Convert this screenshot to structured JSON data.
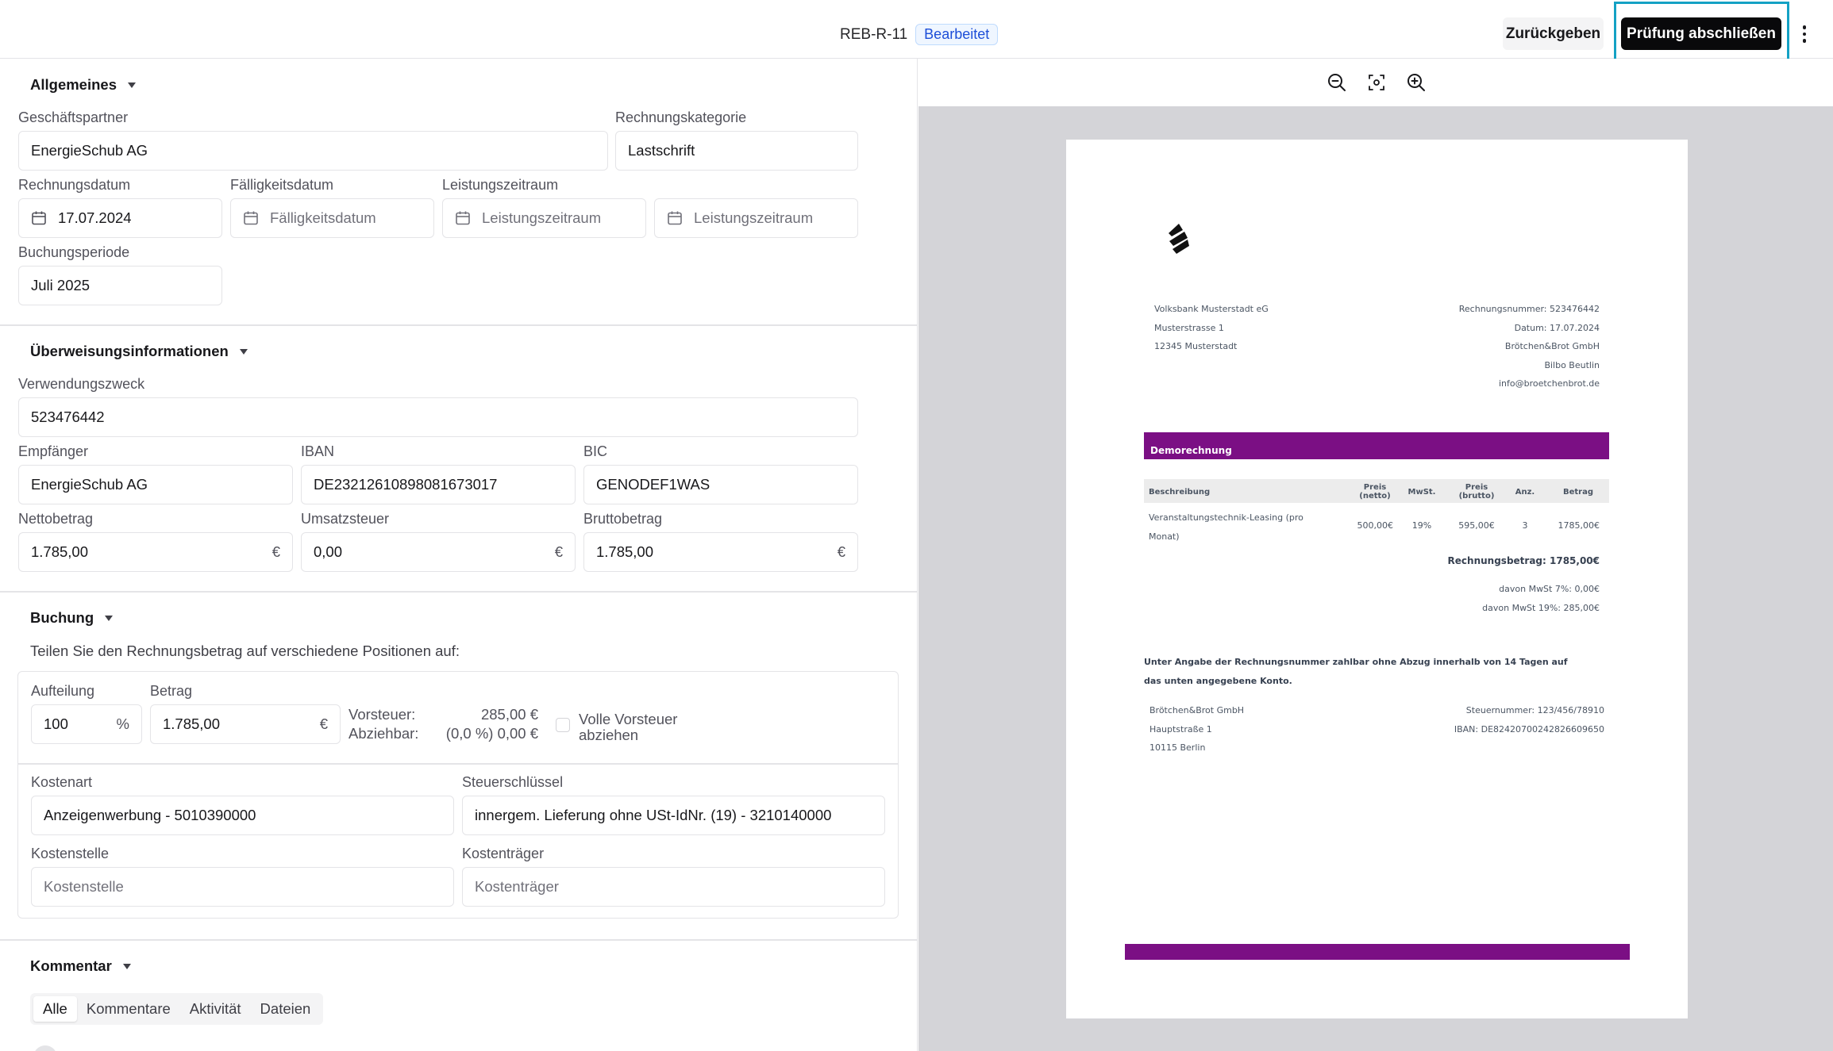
{
  "header": {
    "doc_id": "REB-R-11",
    "status_badge": "Bearbeitet",
    "return_button": "Zurückgeben",
    "complete_button": "Prüfung abschließen"
  },
  "allgemeines": {
    "title": "Allgemeines",
    "partner_label": "Geschäftspartner",
    "partner_value": "EnergieSchub AG",
    "category_label": "Rechnungskategorie",
    "category_value": "Lastschrift",
    "invoice_date_label": "Rechnungsdatum",
    "invoice_date_value": "17.07.2024",
    "due_date_label": "Fälligkeitsdatum",
    "due_date_placeholder": "Fälligkeitsdatum",
    "service_period_label": "Leistungszeitraum",
    "service_start_placeholder": "Leistungszeitraum",
    "service_end_placeholder": "Leistungszeitraum",
    "booking_period_label": "Buchungsperiode",
    "booking_period_value": "Juli 2025"
  },
  "transfer": {
    "title": "Überweisungsinformationen",
    "purpose_label": "Verwendungszweck",
    "purpose_value": "523476442",
    "recipient_label": "Empfänger",
    "recipient_value": "EnergieSchub AG",
    "iban_label": "IBAN",
    "iban_value": "DE23212610898081673017",
    "bic_label": "BIC",
    "bic_value": "GENODEF1WAS",
    "net_label": "Nettobetrag",
    "net_value": "1.785,00",
    "vat_label": "Umsatzsteuer",
    "vat_value": "0,00",
    "gross_label": "Bruttobetrag",
    "gross_value": "1.785,00",
    "currency": "€"
  },
  "booking": {
    "title": "Buchung",
    "hint": "Teilen Sie den Rechnungsbetrag auf verschiedene Positionen auf:",
    "split_label": "Aufteilung",
    "split_value": "100",
    "split_unit": "%",
    "amount_label": "Betrag",
    "amount_value": "1.785,00",
    "currency": "€",
    "input_tax_label": "Vorsteuer:",
    "input_tax_value": "285,00 €",
    "deductible_label": "Abziehbar:",
    "deductible_value": "(0,0 %) 0,00 €",
    "full_tax_checkbox_line1": "Volle Vorsteuer",
    "full_tax_checkbox_line2": "abziehen",
    "cost_type_label": "Kostenart",
    "cost_type_value": "Anzeigenwerbung - 5010390000",
    "tax_key_label": "Steuerschlüssel",
    "tax_key_value": "innergem. Lieferung ohne USt-IdNr. (19) - 3210140000",
    "cost_center_label": "Kostenstelle",
    "cost_center_placeholder": "Kostenstelle",
    "cost_unit_label": "Kostenträger",
    "cost_unit_placeholder": "Kostenträger"
  },
  "comments": {
    "title": "Kommentar",
    "tabs": [
      "Alle",
      "Kommentare",
      "Aktivität",
      "Dateien"
    ]
  },
  "invoice": {
    "sender_lines": [
      "Volksbank Musterstadt eG",
      "Musterstrasse 1",
      "12345 Musterstadt"
    ],
    "meta_lines": [
      "Rechnungsnummer: 523476442",
      "Datum: 17.07.2024",
      "Brötchen&Brot GmbH",
      "Bilbo Beutlin",
      "info@broetchenbrot.de"
    ],
    "banner_title": "Demorechnung",
    "columns": {
      "description": "Beschreibung",
      "net_price": "Preis (netto)",
      "vat": "MwSt.",
      "gross_price": "Preis (brutto)",
      "qty": "Anz.",
      "amount": "Betrag"
    },
    "row": {
      "description_line1": "Veranstaltungstechnik-Leasing (pro",
      "description_line2": "Monat)",
      "net_price": "500,00€",
      "vat": "19%",
      "gross_price": "595,00€",
      "qty": "3",
      "amount": "1785,00€"
    },
    "total": "Rechnungsbetrag: 1785,00€",
    "vat7": "davon MwSt 7%: 0,00€",
    "vat19": "davon MwSt 19%: 285,00€",
    "payment_note_line1": "Unter Angabe der Rechnungsnummer zahlbar ohne Abzug innerhalb von 14 Tagen auf",
    "payment_note_line2": "das unten angegebene Konto.",
    "footer_left": [
      "Brötchen&Brot GmbH",
      "Hauptstraße 1",
      "10115 Berlin"
    ],
    "footer_right": [
      "Steuernummer: 123/456/78910",
      "IBAN: DE82420700242826609650"
    ],
    "accent_color": "#7b0f84"
  },
  "colors": {
    "primary_button": "#09090b",
    "highlight_border": "#14a1c4",
    "badge_text": "#1d4ed8",
    "preview_background": "#d4d4d8"
  },
  "icons": [
    "calendar-icon",
    "zoom-out-icon",
    "fit-screen-icon",
    "zoom-in-icon",
    "more-vertical-icon",
    "chevron-down-icon",
    "company-logo"
  ]
}
